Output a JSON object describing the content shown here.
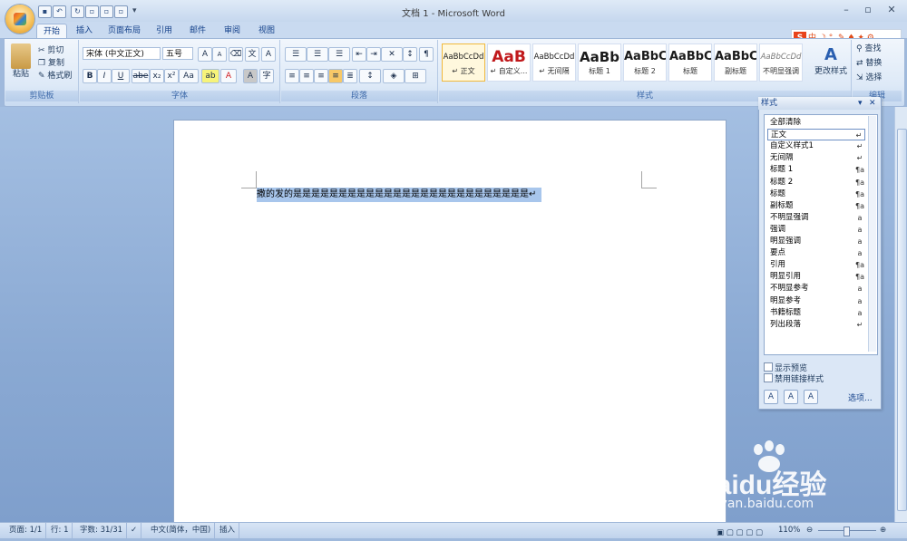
{
  "window": {
    "title": "文档 1 - Microsoft Word"
  },
  "tabs": [
    {
      "label": "开始",
      "active": true
    },
    {
      "label": "插入"
    },
    {
      "label": "页面布局"
    },
    {
      "label": "引用"
    },
    {
      "label": "邮件"
    },
    {
      "label": "审阅"
    },
    {
      "label": "视图"
    }
  ],
  "clipboard": {
    "paste": "粘贴",
    "cut": "剪切",
    "copy": "复制",
    "format_painter": "格式刷",
    "group_label": "剪贴板"
  },
  "font": {
    "name": "宋体 (中文正文)",
    "size": "五号",
    "group_label": "字体",
    "bold": "B",
    "italic": "I",
    "underline": "U",
    "strike": "abe",
    "sub": "x₂",
    "sup": "x²",
    "case": "Aa",
    "grow": "A",
    "shrink": "A",
    "highlight": "ab",
    "color": "A",
    "charshade": "A",
    "encircle": "字"
  },
  "paragraph": {
    "group_label": "段落"
  },
  "styles_gallery": {
    "group_label": "样式",
    "items": [
      {
        "sample": "AaBbCcDd",
        "name": "↵ 正文"
      },
      {
        "sample": "AaB",
        "name": "↵ 自定义..."
      },
      {
        "sample": "AaBbCcDd",
        "name": "↵ 无间隔"
      },
      {
        "sample": "AaBb",
        "name": "标题 1"
      },
      {
        "sample": "AaBbC",
        "name": "标题 2"
      },
      {
        "sample": "AaBbC",
        "name": "标题"
      },
      {
        "sample": "AaBbC",
        "name": "副标题"
      },
      {
        "sample": "AaBbCcDd",
        "name": "不明显强调"
      }
    ],
    "change_styles": "更改样式"
  },
  "editing": {
    "replace": "替换",
    "select": "选择",
    "find": "查找",
    "group_label": "编辑"
  },
  "document": {
    "text": "撒的发的是是是是是是是是是是是是是是是是是是是是是是是是是是↵"
  },
  "styles_pane": {
    "title": "样式",
    "items": [
      {
        "name": "全部清除",
        "glyph": ""
      },
      {
        "name": "正文",
        "glyph": "↵",
        "selected": true
      },
      {
        "name": "自定义样式1",
        "glyph": "↵"
      },
      {
        "name": "无间隔",
        "glyph": "↵"
      },
      {
        "name": "标题 1",
        "glyph": "¶a"
      },
      {
        "name": "标题 2",
        "glyph": "¶a"
      },
      {
        "name": "标题",
        "glyph": "¶a"
      },
      {
        "name": "副标题",
        "glyph": "¶a"
      },
      {
        "name": "不明显强调",
        "glyph": "a"
      },
      {
        "name": "强调",
        "glyph": "a"
      },
      {
        "name": "明显强调",
        "glyph": "a"
      },
      {
        "name": "要点",
        "glyph": "a"
      },
      {
        "name": "引用",
        "glyph": "¶a"
      },
      {
        "name": "明显引用",
        "glyph": "¶a"
      },
      {
        "name": "不明显参考",
        "glyph": "a"
      },
      {
        "name": "明显参考",
        "glyph": "a"
      },
      {
        "name": "书籍标题",
        "glyph": "a"
      },
      {
        "name": "列出段落",
        "glyph": "↵"
      }
    ],
    "show_preview": "显示预览",
    "disable_linked": "禁用链接样式",
    "options": "选项..."
  },
  "statusbar": {
    "page": "页面: 1/1",
    "line": "行: 1",
    "words": "字数: 31/31",
    "language": "中文(简体，中国)",
    "mode": "插入",
    "zoom": "110%"
  },
  "watermark": {
    "brand": "Baidu经验",
    "url": "jingyan.baidu.com"
  },
  "colors": {
    "accent": "#15428b",
    "selection": "#a8c6ec"
  }
}
